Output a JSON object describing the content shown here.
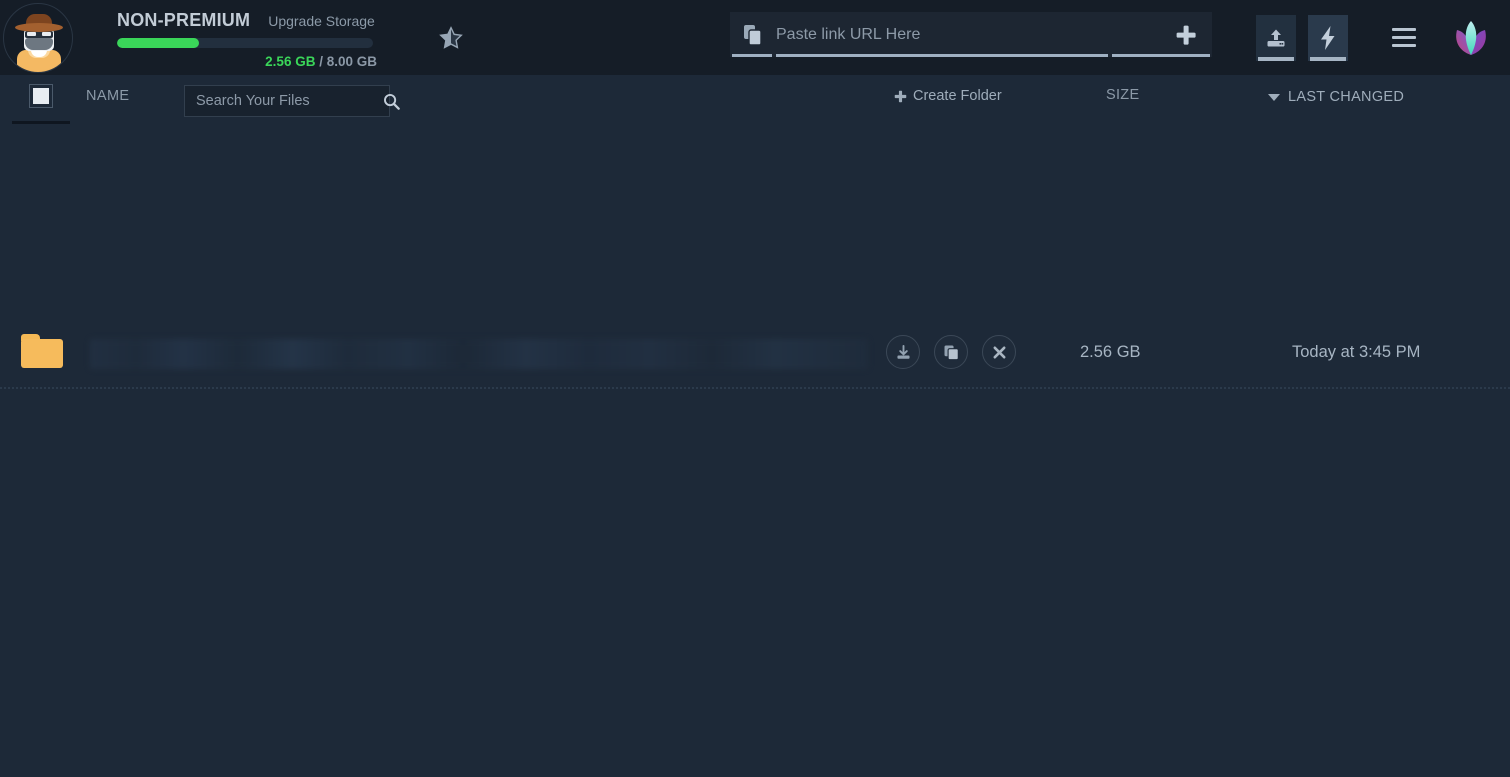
{
  "header": {
    "avatar": {
      "icon": "detective-avatar-icon",
      "alt": "detective avatar"
    },
    "plan": {
      "name": "NON-PREMIUM",
      "upgrade_label": "Upgrade Storage",
      "storage_used": "2.56 GB",
      "storage_separator": " / ",
      "storage_total": "8.00 GB",
      "storage_percent": 32,
      "bar_color": "#3ad659"
    },
    "star": {
      "icon": "half-star-icon"
    },
    "paste_bar": {
      "paste_icon": "paste-clipboard-icon",
      "placeholder": "Paste link URL Here",
      "value": "",
      "add_icon": "plus-icon"
    },
    "actions": [
      {
        "icon": "upload-icon",
        "name": "upload-button",
        "active": false
      },
      {
        "icon": "bolt-icon",
        "name": "remote-upload-button",
        "active": true
      },
      {
        "icon": "hamburger-menu-icon",
        "name": "menu-button"
      },
      {
        "icon": "lotus-brand-logo",
        "name": "brand-logo"
      }
    ]
  },
  "toolbar": {
    "select_all_checked": true,
    "name_column": "NAME",
    "search": {
      "placeholder": "Search Your Files",
      "value": "",
      "icon": "search-icon"
    },
    "create_folder_label": "Create Folder",
    "create_folder_icon": "plus-icon",
    "size_column": "SIZE",
    "last_changed_column": "LAST CHANGED",
    "sort_icon": "caret-down-icon"
  },
  "files": {
    "columns": [
      "name",
      "actions",
      "size",
      "last_changed"
    ],
    "rows": [
      {
        "icon": "folder-icon",
        "name": "",
        "name_redacted": true,
        "size": "2.56 GB",
        "last_changed": "Today at 3:45 PM",
        "actions": [
          {
            "icon": "download-icon",
            "name": "download-button"
          },
          {
            "icon": "copy-icon",
            "name": "copy-button"
          },
          {
            "icon": "close-icon",
            "name": "delete-button"
          }
        ]
      }
    ]
  },
  "colors": {
    "header_bg": "#151d27",
    "body_bg": "#1d2938",
    "accent_green": "#3ad659",
    "folder_yellow": "#f6bb5c",
    "text_muted": "#8c9aa8"
  }
}
